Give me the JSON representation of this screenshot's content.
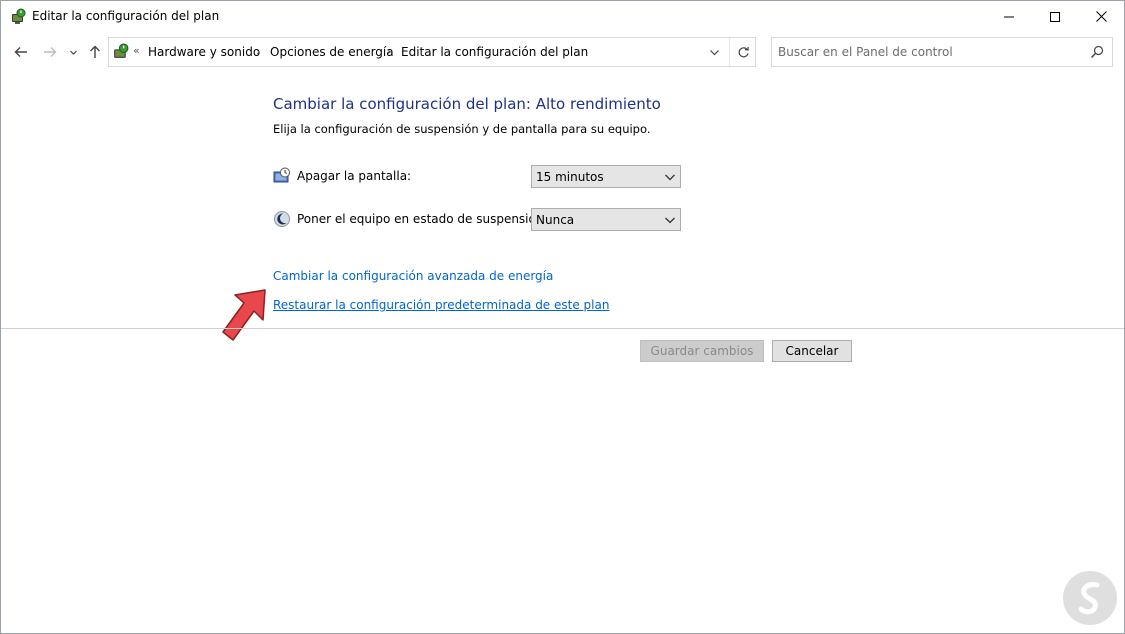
{
  "window": {
    "title": "Editar la configuración del plan",
    "title_icon": "power-options-icon"
  },
  "titlebar_buttons": {
    "minimize_icon": "minimize-icon",
    "maximize_icon": "maximize-icon",
    "close_icon": "close-icon"
  },
  "nav": {
    "back_icon": "back-arrow-icon",
    "forward_icon": "forward-arrow-icon",
    "recent_icon": "chevron-down-icon",
    "up_icon": "up-arrow-icon"
  },
  "address": {
    "overflow": "«",
    "breadcrumbs": [
      "Hardware y sonido",
      "Opciones de energía",
      "Editar la configuración del plan"
    ],
    "separator": "›",
    "dropdown_icon": "chevron-down-icon",
    "refresh_icon": "refresh-icon"
  },
  "search": {
    "placeholder": "Buscar en el Panel de control",
    "value": "",
    "icon": "search-icon"
  },
  "main": {
    "title": "Cambiar la configuración del plan: Alto rendimiento",
    "subtitle": "Elija la configuración de suspensión y de pantalla para su equipo.",
    "settings": [
      {
        "label": "Apagar la pantalla:",
        "value": "15 minutos",
        "icon": "monitor-clock-icon"
      },
      {
        "label": "Poner el equipo en estado de suspensión:",
        "value": "Nunca",
        "icon": "moon-sleep-icon"
      }
    ],
    "links": {
      "advanced": "Cambiar la configuración avanzada de energía",
      "restore": "Restaurar la configuración predeterminada de este plan"
    },
    "buttons": {
      "save": "Guardar cambios",
      "cancel": "Cancelar"
    }
  },
  "annotation": {
    "arrow_color": "#e8474b",
    "icon": "pointer-arrow-icon"
  },
  "colors": {
    "heading": "#1e3287",
    "link": "#0066cc"
  }
}
